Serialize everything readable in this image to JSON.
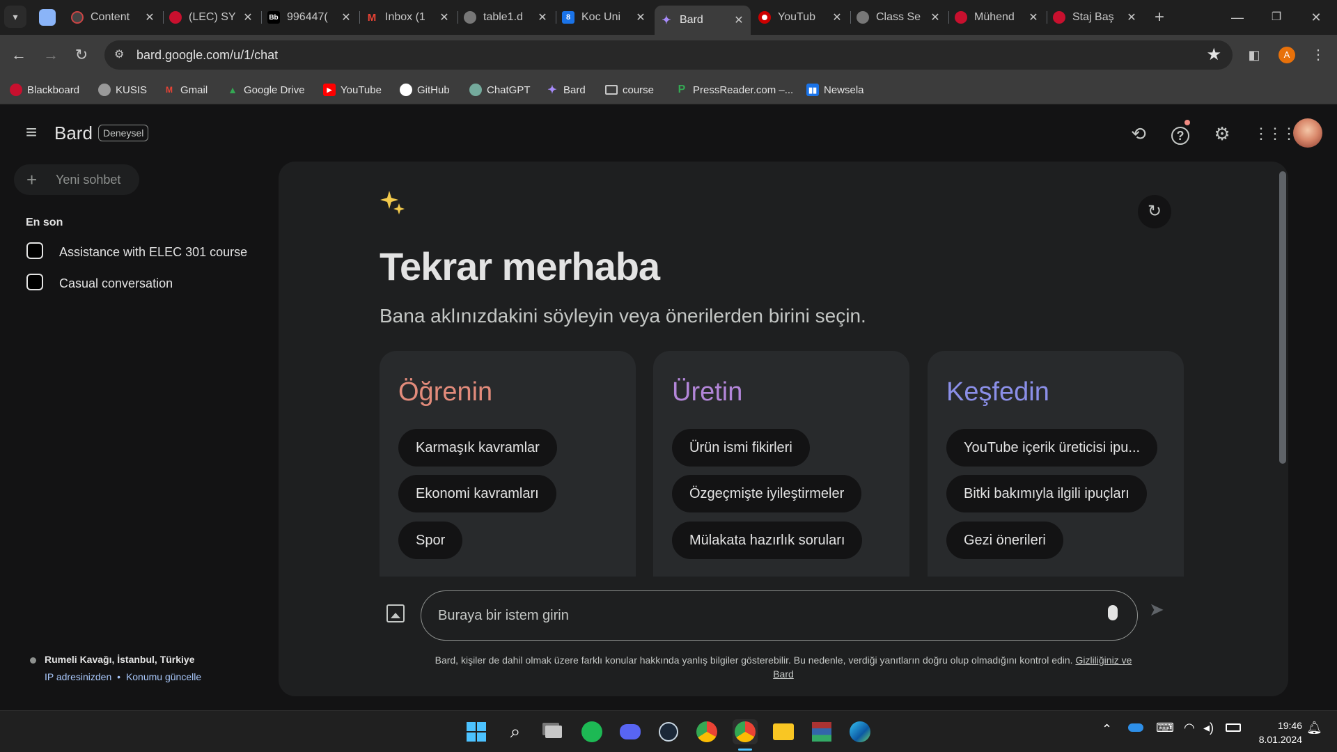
{
  "browser": {
    "tabs": [
      {
        "label": "Content",
        "icon": "content-icon"
      },
      {
        "label": "(LEC) SY",
        "icon": "lec-icon"
      },
      {
        "label": "996447(",
        "icon": "blackboard-icon"
      },
      {
        "label": "Inbox (1",
        "icon": "gmail-icon"
      },
      {
        "label": "table1.d",
        "icon": "globe-icon"
      },
      {
        "label": "Koc Uni",
        "icon": "koc-icon"
      },
      {
        "label": "Bard",
        "icon": "bard-icon"
      },
      {
        "label": "YouTub",
        "icon": "youtube-icon"
      },
      {
        "label": "Class Se",
        "icon": "globe-icon"
      },
      {
        "label": "Mühend",
        "icon": "muhendis-icon"
      },
      {
        "label": "Staj Baş",
        "icon": "staj-icon"
      }
    ],
    "url": "bard.google.com/u/1/chat",
    "profile_initial": "A",
    "bookmarks": [
      {
        "label": "Blackboard",
        "icon": "blackboard-icon"
      },
      {
        "label": "KUSIS",
        "icon": "globe-icon"
      },
      {
        "label": "Gmail",
        "icon": "gmail-icon"
      },
      {
        "label": "Google Drive",
        "icon": "drive-icon"
      },
      {
        "label": "YouTube",
        "icon": "youtube-icon"
      },
      {
        "label": "GitHub",
        "icon": "github-icon"
      },
      {
        "label": "ChatGPT",
        "icon": "chatgpt-icon"
      },
      {
        "label": "Bard",
        "icon": "bard-icon"
      },
      {
        "label": "course",
        "icon": "folder-icon"
      },
      {
        "label": "PressReader.com –...",
        "icon": "pressreader-icon"
      },
      {
        "label": "Newsela",
        "icon": "newsela-icon"
      }
    ]
  },
  "app": {
    "title": "Bard",
    "badge": "Deneysel",
    "new_chat": "Yeni sohbet",
    "recent_label": "En son",
    "recent": [
      {
        "label": "Assistance with ELEC 301 course"
      },
      {
        "label": "Casual conversation"
      }
    ],
    "location": "Rumeli Kavağı, İstanbul, Türkiye",
    "location_source": "IP adresinizden",
    "location_separator": "•",
    "location_update": "Konumu güncelle",
    "greeting": "Tekrar merhaba",
    "subtitle": "Bana aklınızdakini söyleyin veya önerilerden birini seçin.",
    "cards": [
      {
        "title": "Öğrenin",
        "color": "#e28b7b",
        "chips": [
          "Karmaşık kavramlar",
          "Ekonomi kavramları",
          "Spor"
        ]
      },
      {
        "title": "Üretin",
        "color": "#b386d9",
        "chips": [
          "Ürün ismi fikirleri",
          "Özgeçmişte iyileştirmeler",
          "Mülakata hazırlık soruları"
        ]
      },
      {
        "title": "Keşfedin",
        "color": "#8b8fe8",
        "chips": [
          "YouTube içerik üreticisi ipu...",
          "Bitki bakımıyla ilgili ipuçları",
          "Gezi önerileri"
        ]
      }
    ],
    "prompt_placeholder": "Buraya bir istem girin",
    "disclaimer": "Bard, kişiler de dahil olmak üzere farklı konular hakkında yanlış bilgiler gösterebilir. Bu nedenle, verdiği yanıtların doğru olup olmadığını kontrol edin.",
    "privacy_link_1": "Gizliliğiniz ve",
    "privacy_link_2": "Bard"
  },
  "taskbar": {
    "time": "19:46",
    "date": "8.01.2024"
  },
  "colors": {
    "accent": "#a8c7fa",
    "bg": "#131314",
    "card": "#1e1f20"
  }
}
